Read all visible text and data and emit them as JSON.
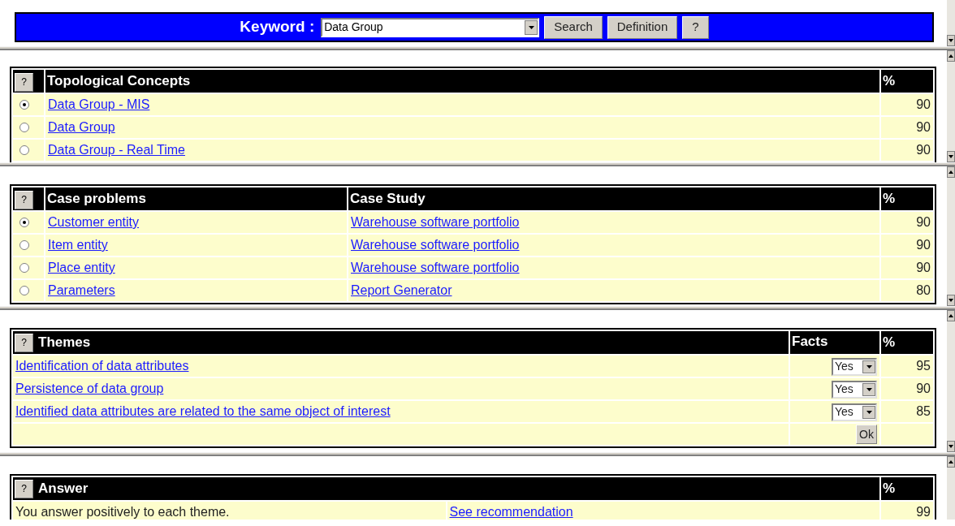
{
  "keyword_bar": {
    "label": "Keyword :",
    "value": "Data Group",
    "buttons": [
      "Search",
      "Definition",
      "?"
    ]
  },
  "topological_concepts": {
    "help": "?",
    "columns": [
      "Topological Concepts",
      "%"
    ],
    "rows": [
      {
        "selected": true,
        "name": "Data Group - MIS",
        "percent": "90"
      },
      {
        "selected": false,
        "name": "Data Group",
        "percent": "90"
      },
      {
        "selected": false,
        "name": "Data Group - Real Time",
        "percent": "90"
      }
    ]
  },
  "case_problems": {
    "help": "?",
    "columns": [
      "Case problems",
      "Case Study",
      "%"
    ],
    "rows": [
      {
        "selected": true,
        "problem": "Customer entity",
        "case_study": "Warehouse software portfolio",
        "percent": "90"
      },
      {
        "selected": false,
        "problem": "Item entity",
        "case_study": "Warehouse software portfolio",
        "percent": "90"
      },
      {
        "selected": false,
        "problem": "Place entity",
        "case_study": "Warehouse software portfolio",
        "percent": "90"
      },
      {
        "selected": false,
        "problem": "Parameters",
        "case_study": "Report Generator",
        "percent": "80"
      }
    ]
  },
  "themes": {
    "help": "?",
    "columns": [
      "Themes",
      "Facts",
      "%"
    ],
    "rows": [
      {
        "theme": "Identification of data attributes",
        "fact": "Yes",
        "percent": "95"
      },
      {
        "theme": "Persistence of data group",
        "fact": "Yes",
        "percent": "90"
      },
      {
        "theme": "Identified data attributes are related to the same object of interest",
        "fact": "Yes",
        "percent": "85"
      }
    ],
    "ok_button": "Ok"
  },
  "answer": {
    "help": "?",
    "columns": [
      "Answer",
      "%"
    ],
    "rows": [
      {
        "text": "You answer positively to each theme.",
        "link": "See recommendation",
        "percent": "99"
      }
    ]
  }
}
